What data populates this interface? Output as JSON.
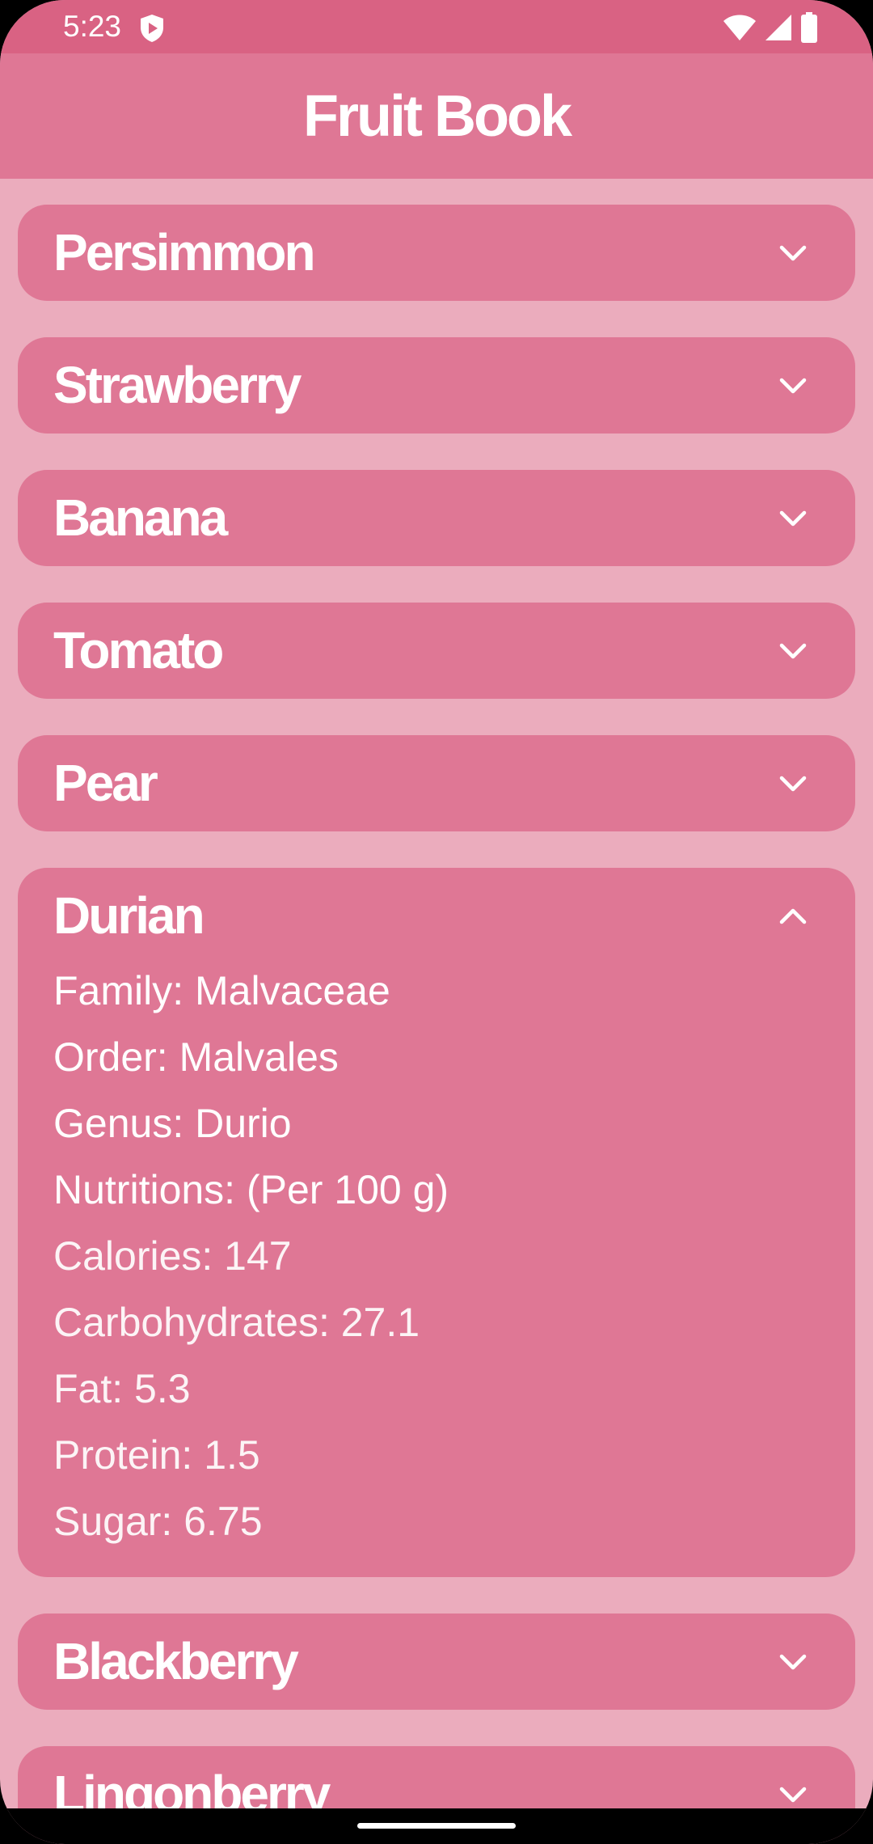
{
  "status_bar": {
    "time": "5:23",
    "icons": [
      "shield-icon",
      "wifi-icon",
      "signal-icon",
      "battery-icon"
    ]
  },
  "app_bar": {
    "title": "Fruit Book"
  },
  "colors": {
    "status_bar": "#d96283",
    "app_bar": "#df7795",
    "background": "#ebacbd",
    "card": "#df7795",
    "text": "#ffffff"
  },
  "fruits": [
    {
      "name": "Persimmon",
      "expanded": false
    },
    {
      "name": "Strawberry",
      "expanded": false
    },
    {
      "name": "Banana",
      "expanded": false
    },
    {
      "name": "Tomato",
      "expanded": false
    },
    {
      "name": "Pear",
      "expanded": false
    },
    {
      "name": "Durian",
      "expanded": true,
      "details": {
        "family": "Family: Malvaceae",
        "order": "Order: Malvales",
        "genus": "Genus: Durio",
        "nutritions_heading": "Nutritions: (Per 100 g)",
        "calories": "Calories: 147",
        "carbohydrates": "Carbohydrates: 27.1",
        "fat": "Fat: 5.3",
        "protein": "Protein: 1.5",
        "sugar": "Sugar: 6.75"
      }
    },
    {
      "name": "Blackberry",
      "expanded": false
    },
    {
      "name": "Lingonberry",
      "expanded": false
    }
  ]
}
